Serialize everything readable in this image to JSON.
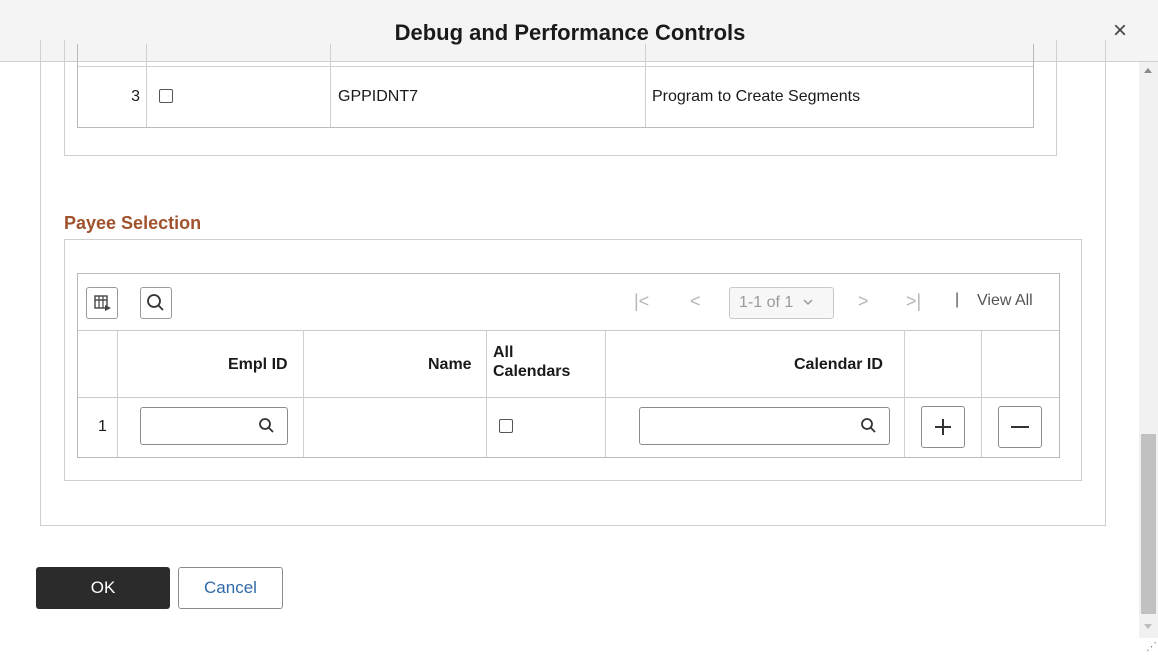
{
  "dialog": {
    "title": "Debug and Performance Controls",
    "close_icon": "close-icon"
  },
  "program_grid": {
    "rows": [
      {
        "row_number": "3",
        "selected": false,
        "program": "GPPIDNT7",
        "description": "Program to Create Segments"
      }
    ]
  },
  "payee_selection": {
    "section_title": "Payee Selection",
    "toolbar": {
      "personalize_icon": "grid-personalize-icon",
      "find_icon": "search-icon",
      "first_glyph": "|<",
      "prev_glyph": "<",
      "page_range": "1-1 of 1",
      "next_glyph": ">",
      "last_glyph": ">|",
      "separator": "|",
      "view_all": "View All"
    },
    "columns": {
      "empl_id": "Empl ID",
      "name": "Name",
      "all_calendars_line1": "All",
      "all_calendars_line2": "Calendars",
      "calendar_id": "Calendar ID"
    },
    "rows": [
      {
        "row_number": "1",
        "empl_id": "",
        "name": "",
        "all_calendars": false,
        "calendar_id": ""
      }
    ],
    "add_row_icon": "plus-icon",
    "delete_row_icon": "minus-icon"
  },
  "footer": {
    "ok_label": "OK",
    "cancel_label": "Cancel"
  },
  "colors": {
    "section_title": "#a0522d",
    "ok_background": "#2b2b2b",
    "cancel_text": "#2f6aa8"
  }
}
